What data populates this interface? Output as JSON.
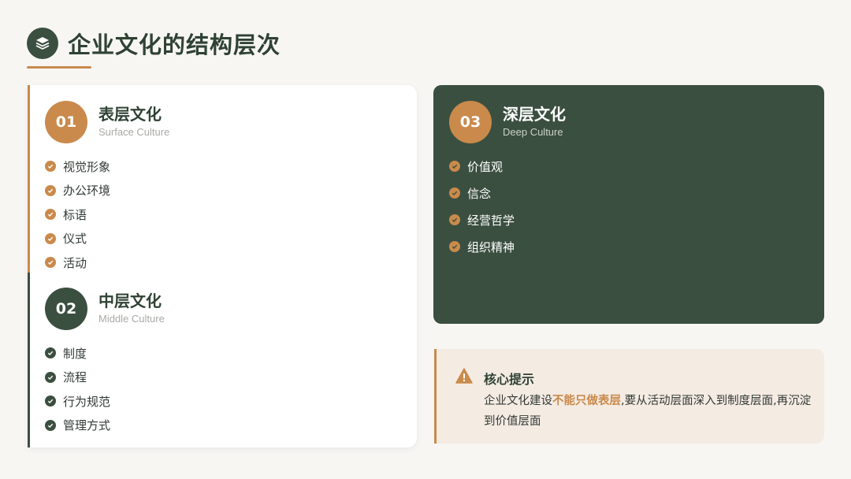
{
  "header": {
    "title": "企业文化的结构层次",
    "icon": "layers-icon"
  },
  "colors": {
    "accent": "#c98a4b",
    "dark_green": "#3b4f40",
    "background": "#f8f6f3",
    "tip_background": "#f4ebe3"
  },
  "surface": {
    "number": "01",
    "title": "表层文化",
    "subtitle": "Surface Culture",
    "items": [
      "视觉形象",
      "办公环境",
      "标语",
      "仪式",
      "活动"
    ]
  },
  "middle": {
    "number": "02",
    "title": "中层文化",
    "subtitle": "Middle Culture",
    "items": [
      "制度",
      "流程",
      "行为规范",
      "管理方式"
    ]
  },
  "deep": {
    "number": "03",
    "title": "深层文化",
    "subtitle": "Deep Culture",
    "items": [
      "价值观",
      "信念",
      "经营哲学",
      "组织精神"
    ]
  },
  "tip": {
    "icon": "warning-icon",
    "title": "核心提示",
    "text_before": "企业文化建设",
    "text_highlight": "不能只做表层",
    "text_after": ",要从活动层面深入到制度层面,再沉淀到价值层面"
  }
}
